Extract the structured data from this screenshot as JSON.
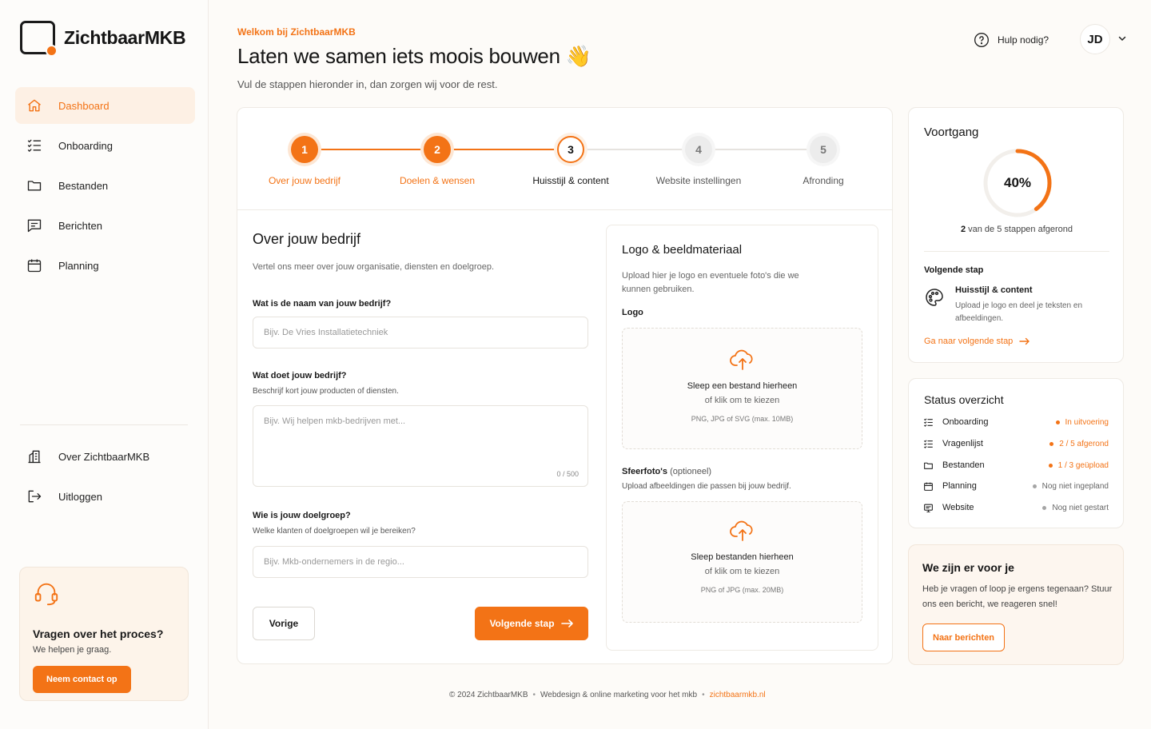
{
  "brand": {
    "name": "ZichtbaarMKB"
  },
  "sidebar": {
    "items": [
      {
        "label": "Dashboard",
        "icon": "home-icon",
        "active": true
      },
      {
        "label": "Onboarding",
        "icon": "checklist-icon"
      },
      {
        "label": "Bestanden",
        "icon": "folder-icon"
      },
      {
        "label": "Berichten",
        "icon": "message-icon"
      },
      {
        "label": "Planning",
        "icon": "calendar-icon"
      }
    ],
    "secondary": [
      {
        "label": "Over ZichtbaarMKB",
        "icon": "building-icon"
      },
      {
        "label": "Uitloggen",
        "icon": "logout-icon"
      }
    ],
    "help_card": {
      "title": "Vragen over het proces?",
      "text": "We helpen je graag.",
      "button": "Neem contact op"
    }
  },
  "header": {
    "welcome": "Welkom bij ZichtbaarMKB",
    "title": "Laten we samen iets moois bouwen 👋",
    "subtitle": "Vul de stappen hieronder in, dan zorgen wij voor de rest.",
    "help_link": "Hulp nodig?",
    "avatar_initials": "JD"
  },
  "stepper": {
    "steps": [
      {
        "number": "1",
        "label": "Over jouw bedrijf",
        "state": "done"
      },
      {
        "number": "2",
        "label": "Doelen & wensen",
        "state": "done"
      },
      {
        "number": "3",
        "label": "Huisstijl & content",
        "state": "current"
      },
      {
        "number": "4",
        "label": "Website instellingen",
        "state": "todo"
      },
      {
        "number": "5",
        "label": "Afronding",
        "state": "todo"
      }
    ]
  },
  "form": {
    "title": "Over jouw bedrijf",
    "description": "Vertel ons meer over jouw organisatie, diensten en doelgroep.",
    "q1": {
      "label": "Wat is de naam van jouw bedrijf?",
      "placeholder": "Bijv. De Vries Installatietechniek"
    },
    "q2": {
      "label": "Wat doet jouw bedrijf?",
      "help": "Beschrijf kort jouw producten of diensten.",
      "placeholder": "Bijv. Wij helpen mkb-bedrijven met...",
      "counter": "0 / 500"
    },
    "q3": {
      "label": "Wie is jouw doelgroep?",
      "help": "Welke klanten of doelgroepen wil je bereiken?",
      "placeholder": "Bijv. Mkb-ondernemers in de regio..."
    },
    "prev_button": "Vorige",
    "next_button": "Volgende stap"
  },
  "upload": {
    "title": "Logo & beeldmateriaal",
    "description": "Upload hier je logo en eventuele foto's die we kunnen gebruiken.",
    "logo": {
      "label": "Logo",
      "line1": "Sleep een bestand hierheen",
      "line2": "of klik om te kiezen",
      "formats": "PNG, JPG of SVG (max. 10MB)"
    },
    "photos": {
      "label": "Sfeerfoto's",
      "optional": "(optioneel)",
      "help": "Upload afbeeldingen die passen bij jouw bedrijf.",
      "line1": "Sleep bestanden hierheen",
      "line2": "of klik om te kiezen",
      "formats": "PNG of JPG (max. 20MB)"
    }
  },
  "progress": {
    "title": "Voortgang",
    "percent_value": 40,
    "percent_label": "40%",
    "done_count": "2",
    "done_text": "van de 5 stappen afgerond",
    "next_heading": "Volgende stap",
    "next_title": "Huisstijl & content",
    "next_desc": "Upload je logo en deel je teksten en afbeeldingen.",
    "next_link": "Ga naar volgende stap"
  },
  "status": {
    "title": "Status overzicht",
    "rows": [
      {
        "label": "Onboarding",
        "value": "In uitvoering",
        "color": "#f37316",
        "icon": "checklist-icon"
      },
      {
        "label": "Vragenlijst",
        "value": "2 / 5 afgerond",
        "color": "#f37316",
        "icon": "checklist-icon"
      },
      {
        "label": "Bestanden",
        "value": "1 / 3 geüpload",
        "color": "#f37316",
        "icon": "folder-icon"
      },
      {
        "label": "Planning",
        "value": "Nog niet ingepland",
        "color": "#9a9a9a",
        "icon": "calendar-icon"
      },
      {
        "label": "Website",
        "value": "Nog niet gestart",
        "color": "#9a9a9a",
        "icon": "monitor-icon"
      }
    ]
  },
  "support": {
    "title": "We zijn er voor je",
    "text": "Heb je vragen of loop je ergens tegenaan? Stuur ons een bericht, we reageren snel!",
    "button": "Naar berichten"
  },
  "footer": {
    "copyright": "© 2024 ZichtbaarMKB",
    "tagline": "Webdesign & online marketing voor het mkb",
    "link": "zichtbaarmkb.nl"
  },
  "colors": {
    "accent": "#f37316",
    "accent_soft": "#fdf0e4"
  }
}
